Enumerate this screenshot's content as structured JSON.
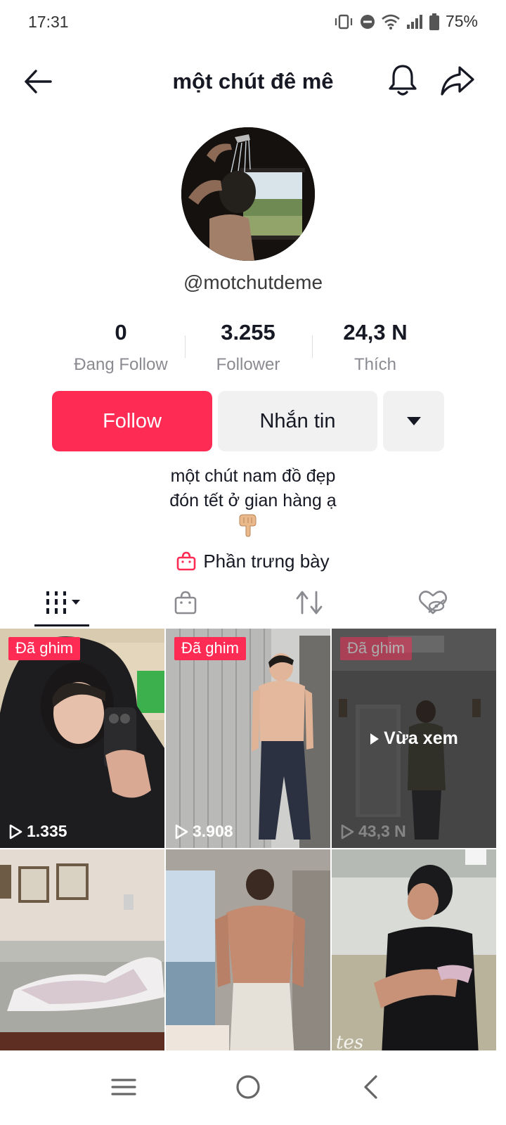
{
  "status_bar": {
    "time": "17:31",
    "battery": "75%"
  },
  "header": {
    "title": "một chút đê mê"
  },
  "profile": {
    "username": "@motchutdeme",
    "stats": [
      {
        "value": "0",
        "label": "Đang Follow"
      },
      {
        "value": "3.255",
        "label": "Follower"
      },
      {
        "value": "24,3 N",
        "label": "Thích"
      }
    ],
    "follow_label": "Follow",
    "message_label": "Nhắn tin",
    "bio_line1": "một chút nam đồ đẹp",
    "bio_line2": "đón tết ở gian hàng ạ",
    "bio_emoji": "pointing-down-hand",
    "showcase_label": "Phần trưng bày"
  },
  "tabs": [
    {
      "icon": "grid-icon",
      "active": true
    },
    {
      "icon": "shop-bag-icon",
      "active": false
    },
    {
      "icon": "repost-icon",
      "active": false
    },
    {
      "icon": "liked-hidden-icon",
      "active": false
    }
  ],
  "videos": [
    {
      "pinned_label": "Đã ghim",
      "views": "1.335"
    },
    {
      "pinned_label": "Đã ghim",
      "views": "3.908"
    },
    {
      "pinned_label": "Đã ghim",
      "views": "43,3 N",
      "watched_label": "Vừa xem"
    },
    {
      "views": ""
    },
    {
      "views": ""
    },
    {
      "overlay_text": "tes",
      "views": ""
    }
  ],
  "colors": {
    "accent": "#fe2c55",
    "secondary_button": "#f1f1f2",
    "text": "#161823",
    "muted": "#8a8b91"
  }
}
